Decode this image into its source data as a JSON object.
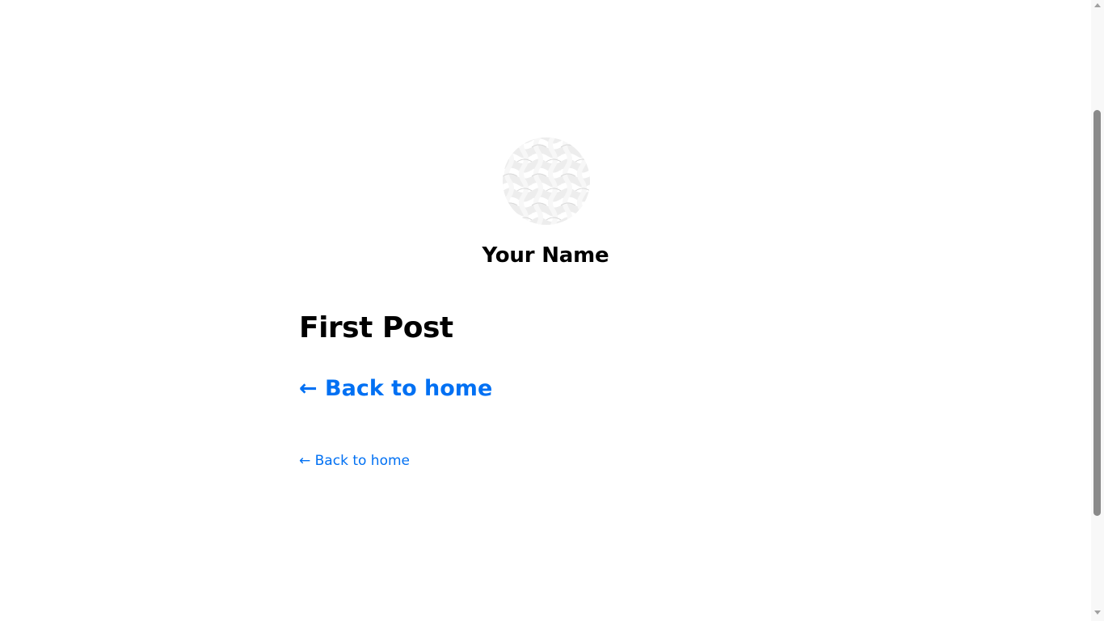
{
  "header": {
    "avatar_alt": "Your Name",
    "site_name": "Your Name"
  },
  "post": {
    "title": "First Post",
    "back_link_large": "← Back to home"
  },
  "footer": {
    "back_link_small": "← Back to home"
  },
  "colors": {
    "link": "#0070f3",
    "text": "#000000",
    "background": "#ffffff"
  }
}
